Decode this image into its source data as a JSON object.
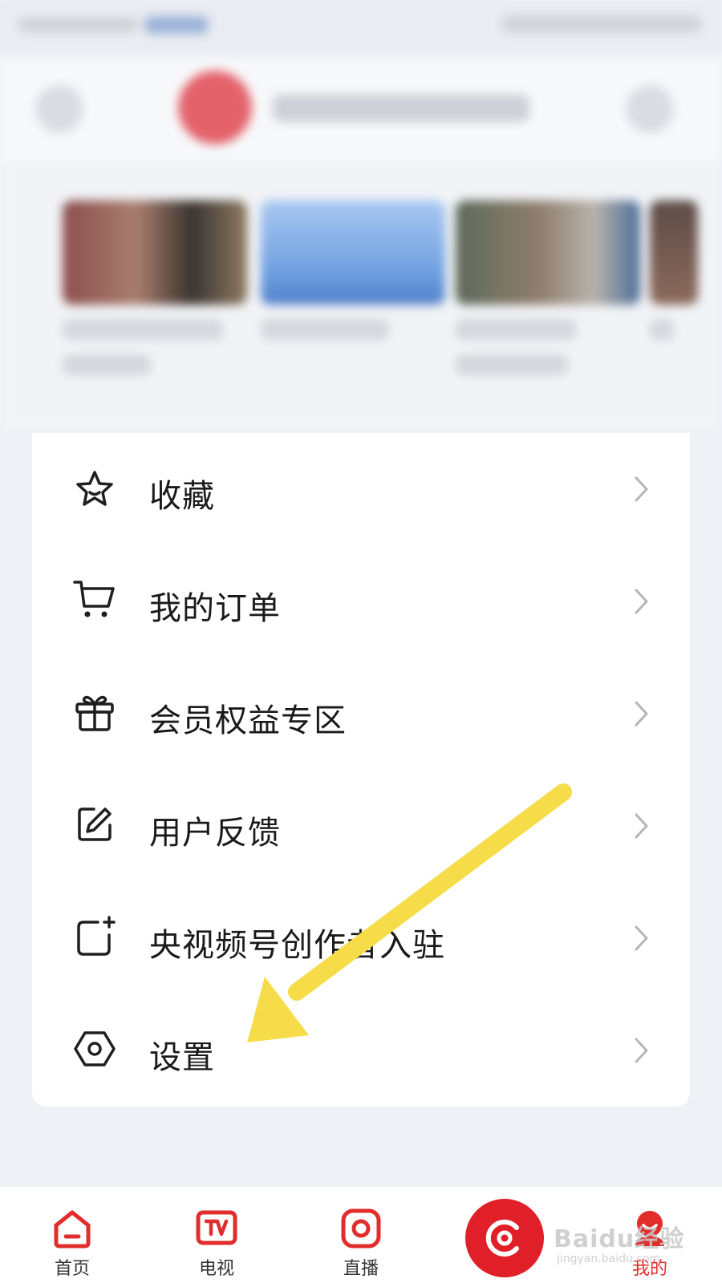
{
  "menu": {
    "items": [
      {
        "label": "收藏",
        "icon": "star-icon"
      },
      {
        "label": "我的订单",
        "icon": "cart-icon"
      },
      {
        "label": "会员权益专区",
        "icon": "gift-icon"
      },
      {
        "label": "用户反馈",
        "icon": "edit-icon"
      },
      {
        "label": "央视频号创作者入驻",
        "icon": "creator-add-icon"
      },
      {
        "label": "设置",
        "icon": "settings-hexagon-icon"
      }
    ]
  },
  "bottom_nav": {
    "items": [
      {
        "label": "首页",
        "icon": "home-icon",
        "active": false
      },
      {
        "label": "电视",
        "icon": "tv-icon",
        "active": false
      },
      {
        "label": "直播",
        "icon": "live-icon",
        "active": false
      },
      {
        "label": "我的",
        "icon": "profile-icon",
        "active": true
      }
    ],
    "center_icon": "cctv-logo-icon"
  },
  "watermark": {
    "main": "Baidu经验",
    "sub": "jingyan.baidu.com"
  },
  "colors": {
    "accent": "#e22d2d",
    "annotation": "#f7dc4a",
    "background": "#eef1f5",
    "card": "#ffffff"
  }
}
